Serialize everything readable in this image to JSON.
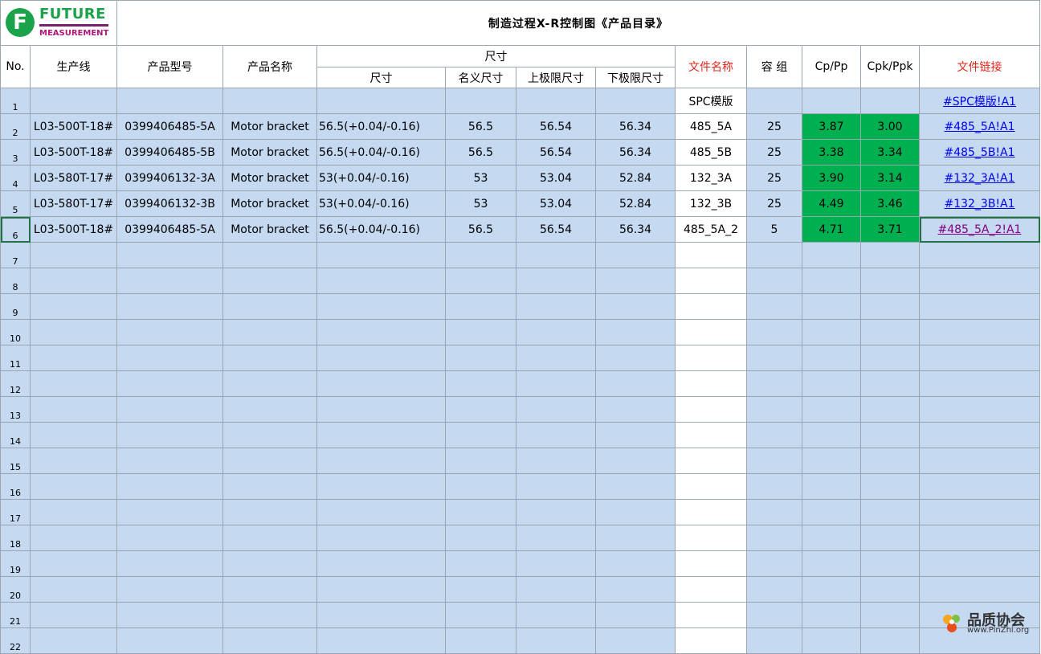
{
  "logo": {
    "line1": "FUTURE",
    "line2": "MEASUREMENT",
    "letter": "F"
  },
  "title": "制造过程X-R控制图《产品目录》",
  "headers": {
    "no": "No.",
    "line": "生产线",
    "model": "产品型号",
    "name": "产品名称",
    "dim_group": "尺寸",
    "dim": "尺寸",
    "nominal": "名义尺寸",
    "upper": "上极限尺寸",
    "lower": "下极限尺寸",
    "file": "文件名称",
    "group": "容 组",
    "cp": "Cp/Pp",
    "cpk": "Cpk/Ppk",
    "link": "文件链接"
  },
  "rows": [
    {
      "no": "1",
      "line": "",
      "model": "",
      "name": "",
      "dim": "",
      "nominal": "",
      "upper": "",
      "lower": "",
      "file": "SPC模版",
      "group": "",
      "cp": "",
      "cpk": "",
      "link": "#SPC模版!A1"
    },
    {
      "no": "2",
      "line": "L03-500T-18#",
      "model": "0399406485-5A",
      "name": "Motor bracket",
      "dim": "56.5(+0.04/-0.16)",
      "nominal": "56.5",
      "upper": "56.54",
      "lower": "56.34",
      "file": "485_5A",
      "group": "25",
      "cp": "3.87",
      "cpk": "3.00",
      "link": "#485_5A!A1"
    },
    {
      "no": "3",
      "line": "L03-500T-18#",
      "model": "0399406485-5B",
      "name": "Motor bracket",
      "dim": "56.5(+0.04/-0.16)",
      "nominal": "56.5",
      "upper": "56.54",
      "lower": "56.34",
      "file": "485_5B",
      "group": "25",
      "cp": "3.38",
      "cpk": "3.34",
      "link": "#485_5B!A1"
    },
    {
      "no": "4",
      "line": "L03-580T-17#",
      "model": "0399406132-3A",
      "name": "Motor bracket",
      "dim": "53(+0.04/-0.16)",
      "nominal": "53",
      "upper": "53.04",
      "lower": "52.84",
      "file": "132_3A",
      "group": "25",
      "cp": "3.90",
      "cpk": "3.14",
      "link": "#132_3A!A1"
    },
    {
      "no": "5",
      "line": "L03-580T-17#",
      "model": "0399406132-3B",
      "name": "Motor bracket",
      "dim": "53(+0.04/-0.16)",
      "nominal": "53",
      "upper": "53.04",
      "lower": "52.84",
      "file": "132_3B",
      "group": "25",
      "cp": "4.49",
      "cpk": "3.46",
      "link": "#132_3B!A1"
    },
    {
      "no": "6",
      "line": "L03-500T-18#",
      "model": "0399406485-5A",
      "name": "Motor bracket",
      "dim": "56.5(+0.04/-0.16)",
      "nominal": "56.5",
      "upper": "56.54",
      "lower": "56.34",
      "file": "485_5A_2",
      "group": "5",
      "cp": "4.71",
      "cpk": "3.71",
      "link": "#485_5A_2!A1"
    }
  ],
  "empty_row_numbers": [
    "7",
    "8",
    "9",
    "10",
    "11",
    "12",
    "13",
    "14",
    "15",
    "16",
    "17",
    "18",
    "19",
    "20",
    "21",
    "22"
  ],
  "watermark": {
    "name": "品质协会",
    "url": "www.PinZhi.org"
  },
  "colors": {
    "row_fill": "#c5d9f1",
    "cp_fill": "#00b050",
    "header_red": "#e4261a",
    "link": "#0000ee",
    "link_visited": "#800080",
    "logo_green": "#1aa34a",
    "logo_magenta": "#b0177a"
  }
}
